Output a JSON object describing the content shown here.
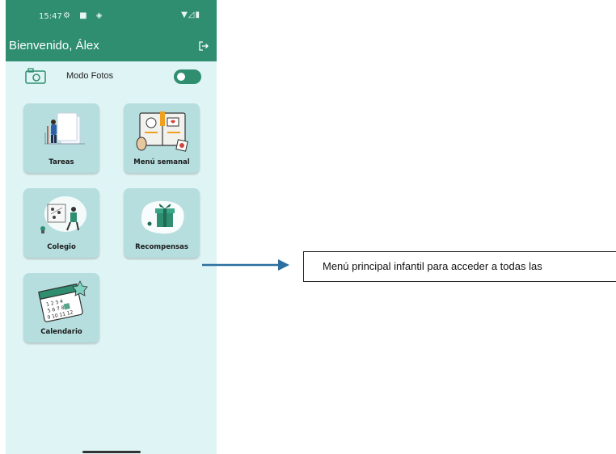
{
  "status_bar": {
    "time": "15:47",
    "left_icons": "⚙ ■ ◈",
    "right_icons": "▼◿▮"
  },
  "app_bar": {
    "title": "Bienvenido, Álex",
    "logout_icon": "logout-icon"
  },
  "photo_mode": {
    "label": "Modo Fotos",
    "enabled": true,
    "icon": "camera-icon"
  },
  "tiles": [
    {
      "label": "Tareas",
      "icon": "tasks-illustration"
    },
    {
      "label": "Menú semanal",
      "icon": "weekly-menu-illustration"
    },
    {
      "label": "Colegio",
      "icon": "school-illustration"
    },
    {
      "label": "Recompensas",
      "icon": "gift-illustration"
    },
    {
      "label": "Calendario",
      "icon": "calendar-illustration"
    }
  ],
  "annotation": {
    "text": "Menú principal infantil para acceder a todas las"
  },
  "colors": {
    "header": "#2e8e6f",
    "screen_bg": "#dff4f4",
    "tile_bg": "#b6dede",
    "arrow": "#2a6fa0"
  }
}
